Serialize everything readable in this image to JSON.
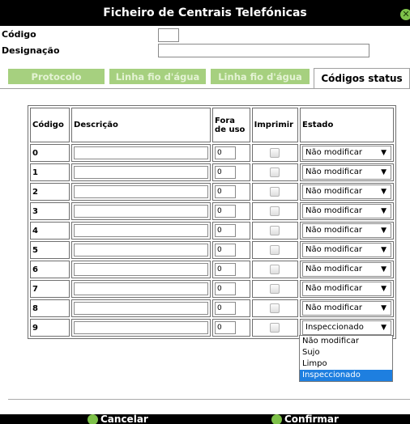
{
  "window": {
    "title": "Ficheiro de Centrais Telefónicas"
  },
  "form": {
    "codigo_label": "Código",
    "codigo_value": "",
    "designacao_label": "Designação",
    "designacao_value": ""
  },
  "tabs": [
    {
      "label": "Protocolo",
      "active": false
    },
    {
      "label": "Linha fio d'água",
      "active": false
    },
    {
      "label": "Linha fio d'água",
      "active": false
    },
    {
      "label": "Códigos status",
      "active": true
    }
  ],
  "table": {
    "headers": {
      "codigo": "Código",
      "descricao": "Descrição",
      "fora": "Fora de uso",
      "imprimir": "Imprimir",
      "estado": "Estado"
    },
    "rows": [
      {
        "codigo": "0",
        "descricao": "",
        "fora": "0",
        "imprimir": false,
        "estado": "Não modificar"
      },
      {
        "codigo": "1",
        "descricao": "",
        "fora": "0",
        "imprimir": false,
        "estado": "Não modificar"
      },
      {
        "codigo": "2",
        "descricao": "",
        "fora": "0",
        "imprimir": false,
        "estado": "Não modificar"
      },
      {
        "codigo": "3",
        "descricao": "",
        "fora": "0",
        "imprimir": false,
        "estado": "Não modificar"
      },
      {
        "codigo": "4",
        "descricao": "",
        "fora": "0",
        "imprimir": false,
        "estado": "Não modificar"
      },
      {
        "codigo": "5",
        "descricao": "",
        "fora": "0",
        "imprimir": false,
        "estado": "Não modificar"
      },
      {
        "codigo": "6",
        "descricao": "",
        "fora": "0",
        "imprimir": false,
        "estado": "Não modificar"
      },
      {
        "codigo": "7",
        "descricao": "",
        "fora": "0",
        "imprimir": false,
        "estado": "Não modificar"
      },
      {
        "codigo": "8",
        "descricao": "",
        "fora": "0",
        "imprimir": false,
        "estado": "Não modificar"
      },
      {
        "codigo": "9",
        "descricao": "",
        "fora": "0",
        "imprimir": false,
        "estado": "Inspeccionado"
      }
    ]
  },
  "dropdown": {
    "options": [
      "Não modificar",
      "Sujo",
      "Limpo",
      "Inspeccionado"
    ],
    "highlighted": "Inspeccionado"
  },
  "footer": {
    "cancel_label": "Cancelar",
    "confirm_label": "Confirmar"
  },
  "colors": {
    "titlebar": "#000000",
    "tab_inactive": "#a6d07f",
    "icon_green": "#7ec14a",
    "highlight": "#1e7fe0"
  }
}
